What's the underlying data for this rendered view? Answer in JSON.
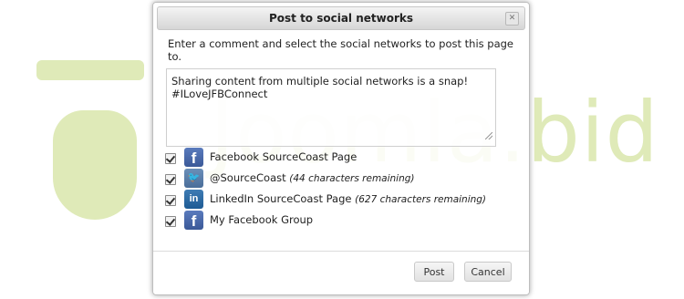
{
  "dialog": {
    "title": "Post to social networks",
    "instruction": "Enter a comment and select the social networks to post this page to.",
    "comment_value": "Sharing content from multiple social networks is a snap! #ILoveJFBConnect",
    "networks": [
      {
        "service": "facebook",
        "icon": "facebook-icon",
        "checked": true,
        "label": "Facebook SourceCoast Page",
        "note": ""
      },
      {
        "service": "twitter",
        "icon": "twitter-icon",
        "checked": true,
        "label": "@SourceCoast",
        "note": "(44 characters remaining)"
      },
      {
        "service": "linkedin",
        "icon": "linkedin-icon",
        "checked": true,
        "label": "LinkedIn SourceCoast Page",
        "note": "(627 characters remaining)"
      },
      {
        "service": "facebook",
        "icon": "facebook-icon",
        "checked": true,
        "label": "My Facebook Group",
        "note": ""
      }
    ],
    "buttons": {
      "post_label": "Post",
      "cancel_label": "Cancel"
    },
    "close_icon": "close-icon"
  },
  "watermark": {
    "text": "Joomla.bid"
  },
  "colors": {
    "facebook": "#3b5998",
    "twitter": "#4a6d99",
    "linkedin": "#1d5b94",
    "watermark": "#dfeab8"
  }
}
